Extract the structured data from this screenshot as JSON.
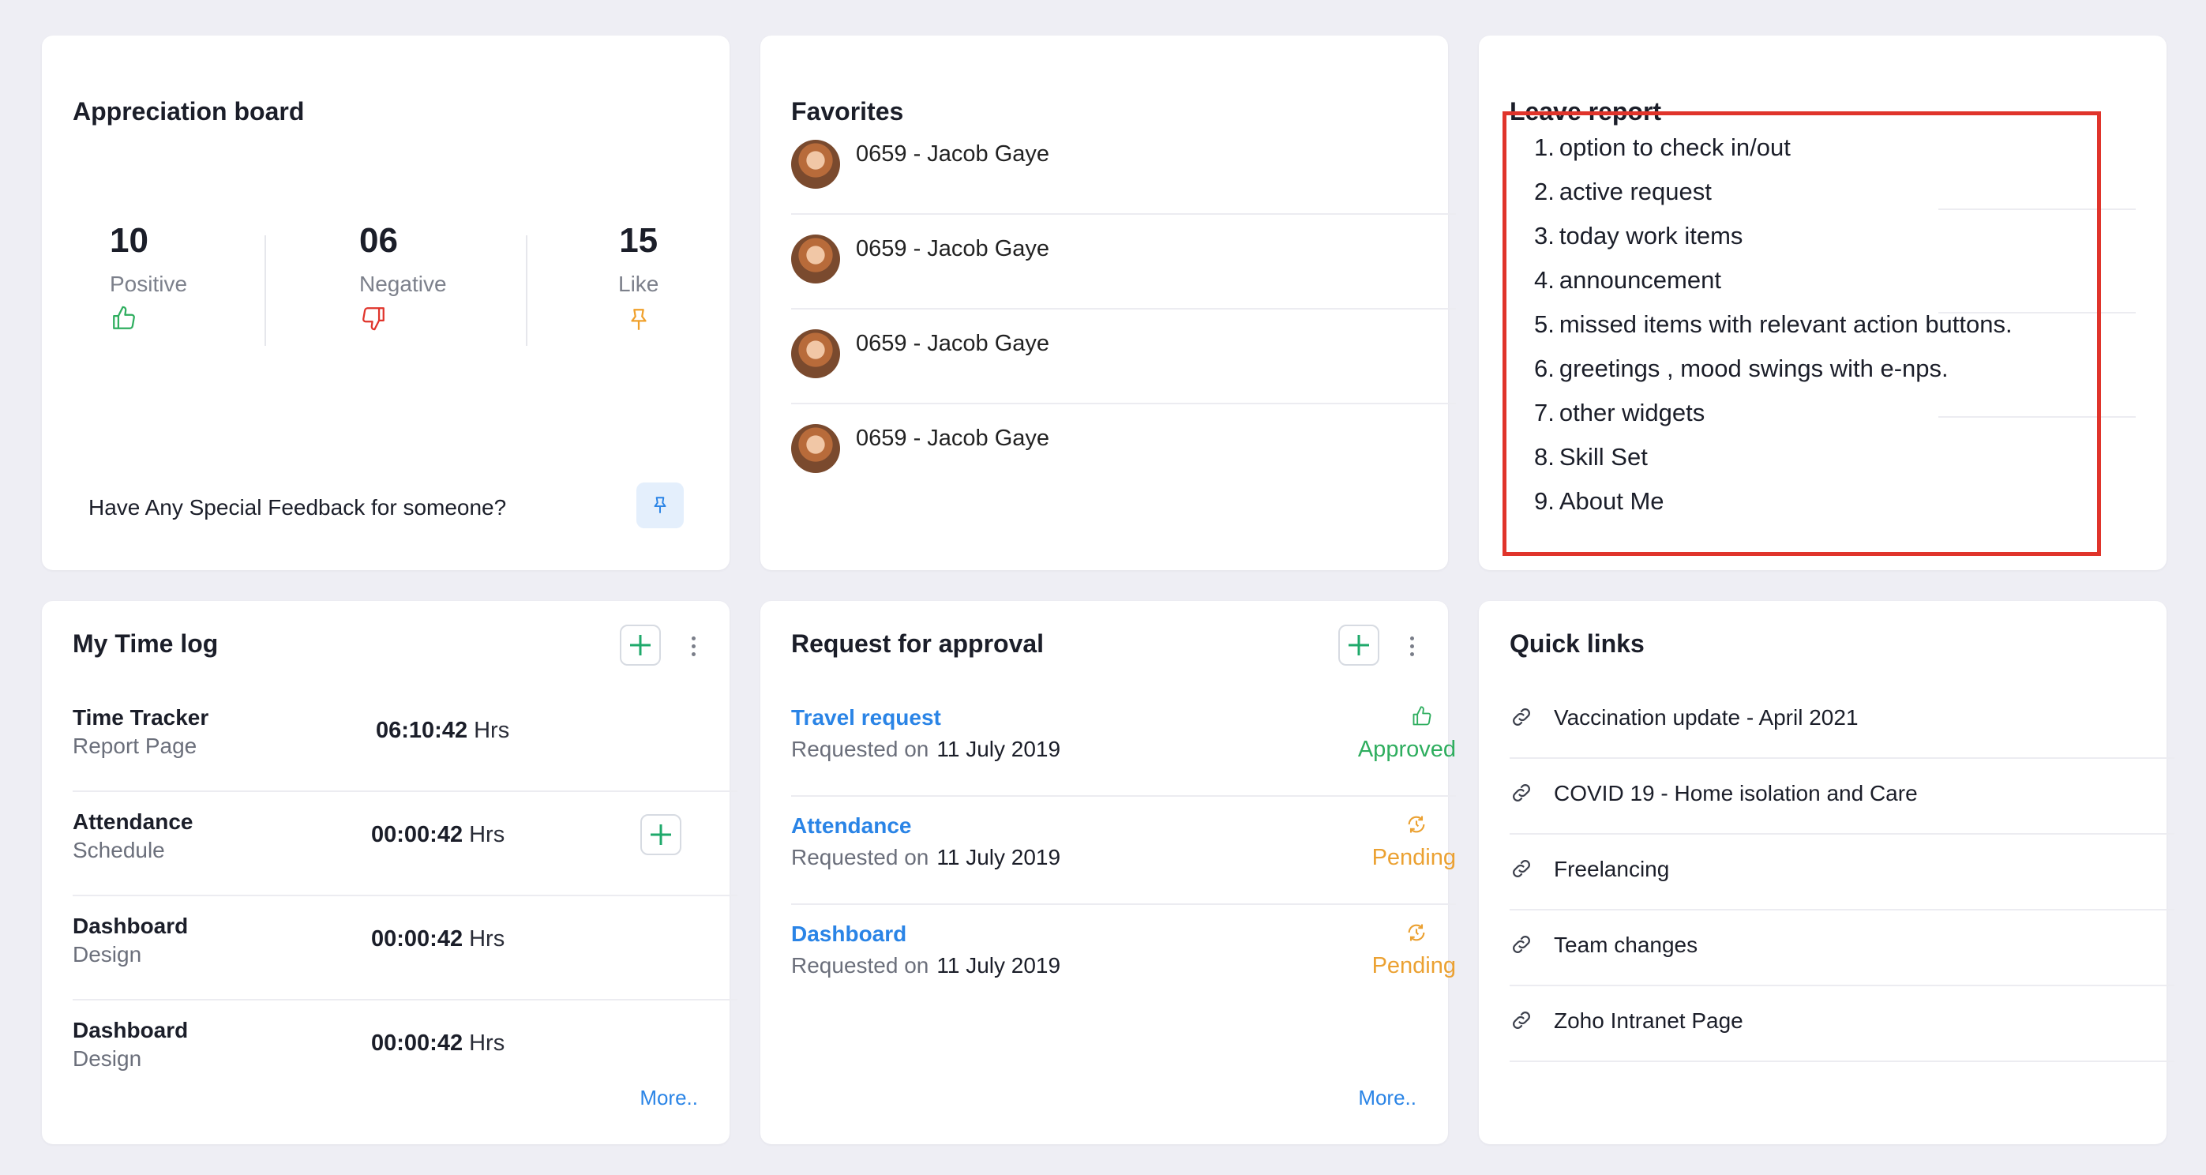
{
  "appreciation": {
    "title": "Appreciation board",
    "stats": [
      {
        "value": "10",
        "label": "Positive"
      },
      {
        "value": "06",
        "label": "Negative"
      },
      {
        "value": "15",
        "label": "Like"
      }
    ],
    "feedback_prompt": "Have Any Special Feedback for someone?",
    "colors": {
      "positive": "#2fae5f",
      "negative": "#e0342b",
      "like": "#f0a02b"
    }
  },
  "favorites": {
    "title": "Favorites",
    "items": [
      {
        "name": "0659 - Jacob Gaye"
      },
      {
        "name": "0659 - Jacob Gaye"
      },
      {
        "name": "0659 - Jacob Gaye"
      },
      {
        "name": "0659 - Jacob Gaye"
      }
    ]
  },
  "leave_report": {
    "title": "Leave report",
    "items": [
      {
        "num": "1.",
        "text": "option to check in/out"
      },
      {
        "num": "2.",
        "text": "active request"
      },
      {
        "num": "3.",
        "text": "today work items"
      },
      {
        "num": "4.",
        "text": "announcement"
      },
      {
        "num": "5.",
        "text": "missed items with relevant action buttons."
      },
      {
        "num": "6.",
        "text": "greetings , mood swings with e-nps."
      },
      {
        "num": "7.",
        "text": "other widgets"
      },
      {
        "num": "8.",
        "text": "Skill Set"
      },
      {
        "num": "9.",
        "text": "About Me"
      }
    ]
  },
  "time_log": {
    "title": "My Time log",
    "rows": [
      {
        "name": "Time Tracker",
        "sub": "Report Page",
        "time": "06:10:42",
        "unit": "Hrs"
      },
      {
        "name": "Attendance",
        "sub": "Schedule",
        "time": "00:00:42",
        "unit": "Hrs"
      },
      {
        "name": "Dashboard",
        "sub": "Design",
        "time": "00:00:42",
        "unit": "Hrs"
      },
      {
        "name": "Dashboard",
        "sub": "Design",
        "time": "00:00:42",
        "unit": "Hrs"
      }
    ],
    "more": "More.."
  },
  "approval": {
    "title": "Request for approval",
    "requested_label": "Requested on",
    "rows": [
      {
        "title": "Travel request",
        "date": "11 July 2019",
        "status": "Approved"
      },
      {
        "title": "Attendance",
        "date": "11 July 2019",
        "status": "Pending"
      },
      {
        "title": "Dashboard",
        "date": "11 July 2019",
        "status": "Pending"
      }
    ],
    "colors": {
      "approved": "#2fae5f",
      "pending": "#eba132"
    },
    "more": "More.."
  },
  "quick_links": {
    "title": "Quick links",
    "items": [
      {
        "label": "Vaccination update - April 2021"
      },
      {
        "label": "COVID 19 - Home isolation and Care"
      },
      {
        "label": "Freelancing"
      },
      {
        "label": "Team changes"
      },
      {
        "label": "Zoho Intranet Page"
      }
    ]
  }
}
